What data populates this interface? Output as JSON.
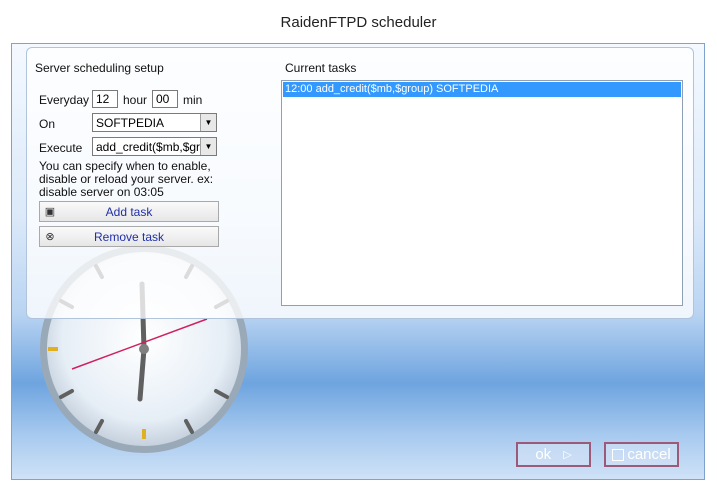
{
  "window": {
    "title": "RaidenFTPD scheduler"
  },
  "left": {
    "section_title": "Server scheduling setup",
    "everyday_label": "Everyday",
    "hour_value": "12",
    "hour_label": "hour",
    "minute_value": "00",
    "min_label": "min",
    "on_label": "On",
    "on_value": "SOFTPEDIA",
    "execute_label": "Execute",
    "execute_value": "add_credit($mb,$grou",
    "help_text": "You can specify when to enable, disable or reload your server.  ex: disable server on 03:05",
    "add_task_label": "Add task",
    "remove_task_label": "Remove task"
  },
  "right": {
    "section_title": "Current tasks",
    "tasks": [
      "12:00 add_credit($mb,$group) SOFTPEDIA"
    ]
  },
  "footer": {
    "ok_label": "ok",
    "cancel_label": "cancel"
  },
  "icons": {
    "add": "add-task-icon",
    "remove": "remove-task-icon",
    "dropdown": "chevron-down-icon"
  },
  "colors": {
    "selection": "#3399ff",
    "link_text": "#2030a8",
    "footer_button_border": "#9b5a7a"
  }
}
